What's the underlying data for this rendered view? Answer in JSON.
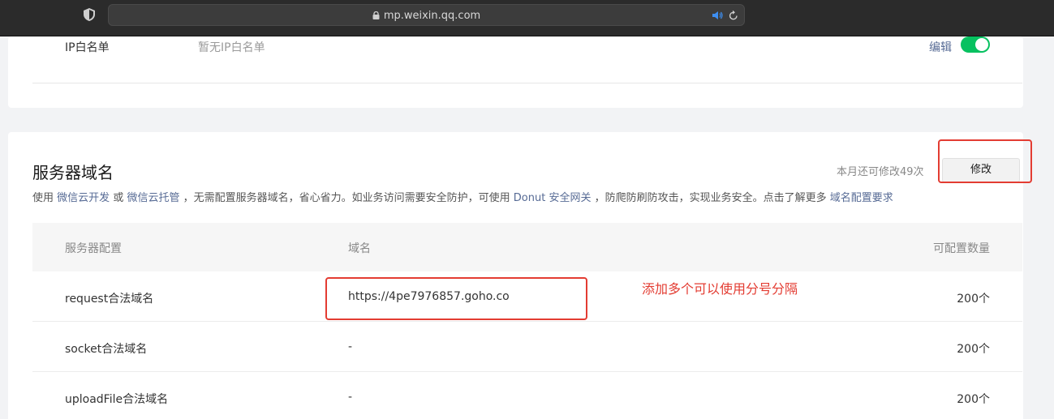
{
  "browser": {
    "url": "mp.weixin.qq.com",
    "icons": [
      "shield-icon",
      "lock-icon",
      "speaker-icon",
      "reload-icon"
    ]
  },
  "ip_whitelist": {
    "label": "IP白名单",
    "value": "暂无IP白名单",
    "edit_label": "编辑",
    "toggle_on": true
  },
  "server_domain": {
    "title": "服务器域名",
    "remaining": "本月还可修改49次",
    "modify_label": "修改",
    "desc": {
      "t1": "使用",
      "link1": "微信云开发",
      "t2": "或",
      "link2": "微信云托管",
      "t3": "，无需配置服务器域名，省心省力。如业务访问需要安全防护，可使用",
      "link3": "Donut 安全网关",
      "t4": "，防爬防刷防攻击，实现业务安全。点击了解更多",
      "link4": "域名配置要求"
    },
    "table": {
      "headers": [
        "服务器配置",
        "域名",
        "可配置数量"
      ],
      "rows": [
        [
          "request合法域名",
          "https://4pe7976857.goho.co",
          "200个"
        ],
        [
          "socket合法域名",
          "-",
          "200个"
        ],
        [
          "uploadFile合法域名",
          "-",
          "200个"
        ]
      ]
    }
  },
  "annotation": {
    "note": "添加多个可以使用分号分隔",
    "color": "#e33c32"
  },
  "colors": {
    "link": "#576b95",
    "toggle": "#07c160"
  }
}
